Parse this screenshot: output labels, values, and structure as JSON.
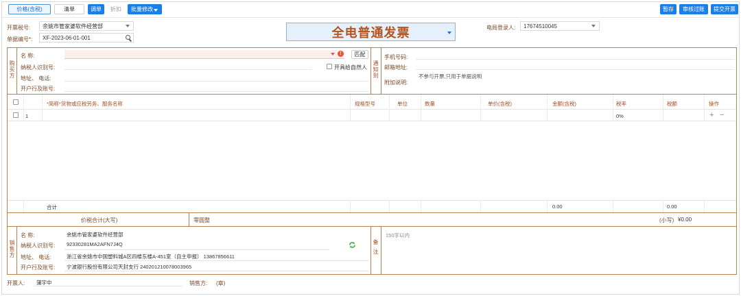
{
  "toolbar": {
    "price_tax_incl": "价格(含税)",
    "list": "清单",
    "adjust": "调单",
    "discount": "折扣",
    "batch_edit": "批量修改",
    "save_draft": "暂存",
    "review": "审核过账",
    "submit": "提交开票"
  },
  "header": {
    "tax_no_label": "开票税号:",
    "tax_no_value": "余姚市管家婆软件经营部",
    "doc_no_label": "单据编号*:",
    "doc_no_value": "XF-2023-06-01-001",
    "invoice_type": "全电普通发票",
    "login_label": "电局登录人:",
    "login_value": "17674510045"
  },
  "buyer": {
    "section_label": "购买方",
    "name_label": "名        称:",
    "taxid_label": "纳税人识别号:",
    "addr_label": "地址、   电话:",
    "bank_label": "开户行及账号:",
    "match_button": "匹配",
    "natural_person": "开具给自然人"
  },
  "notify": {
    "section_label": "通知到",
    "phone_label": "手机号码:",
    "email_label": "邮箱地址:",
    "remark_label": "附加说明:",
    "remark_value": "不参与开票,只用于单据说明"
  },
  "table": {
    "headers": [
      "*简称*货物或应税劳务、服务名称",
      "规格型号",
      "单位",
      "数量",
      "单价(含税)",
      "金额(含税)",
      "税率",
      "税额",
      "操作"
    ],
    "row_index": "1",
    "row_tax_rate": "0%",
    "add_icon": "+",
    "remove_icon": "−",
    "total_label": "合计",
    "total_amount": "0.00",
    "total_tax": "0.00",
    "grand_label": "价税合计(大写)",
    "grand_words": "零圆整",
    "grand_small_label": "(小写)",
    "grand_small_value": "¥0.00"
  },
  "seller": {
    "section_label": "销售方",
    "name_label": "名        称:",
    "name_value": "余姚市管家婆软件经营部",
    "taxid_label": "纳税人识别号:",
    "taxid_value": "92330281MA2AFN7J4Q",
    "addr_label": "地址、   电话:",
    "addr_value": "浙江省余姚市中国塑料城A区四楼东楼A-451室（自主申报） 13867856611",
    "bank_label": "开户行及账号:",
    "bank_value": "宁波银行股份有限公司天封支行 240201210078003965",
    "remark_label": "备注",
    "remark_placeholder": "150字以内"
  },
  "footer": {
    "issuer_label": "开票人:",
    "issuer_value": "蒲宇中",
    "seller_label": "销售方:",
    "seller_value": "(章)"
  },
  "colors": {
    "accent": "#1a7fe8",
    "border": "#b7824e",
    "label": "#a0522d",
    "invoice_title": "#b5541c"
  }
}
